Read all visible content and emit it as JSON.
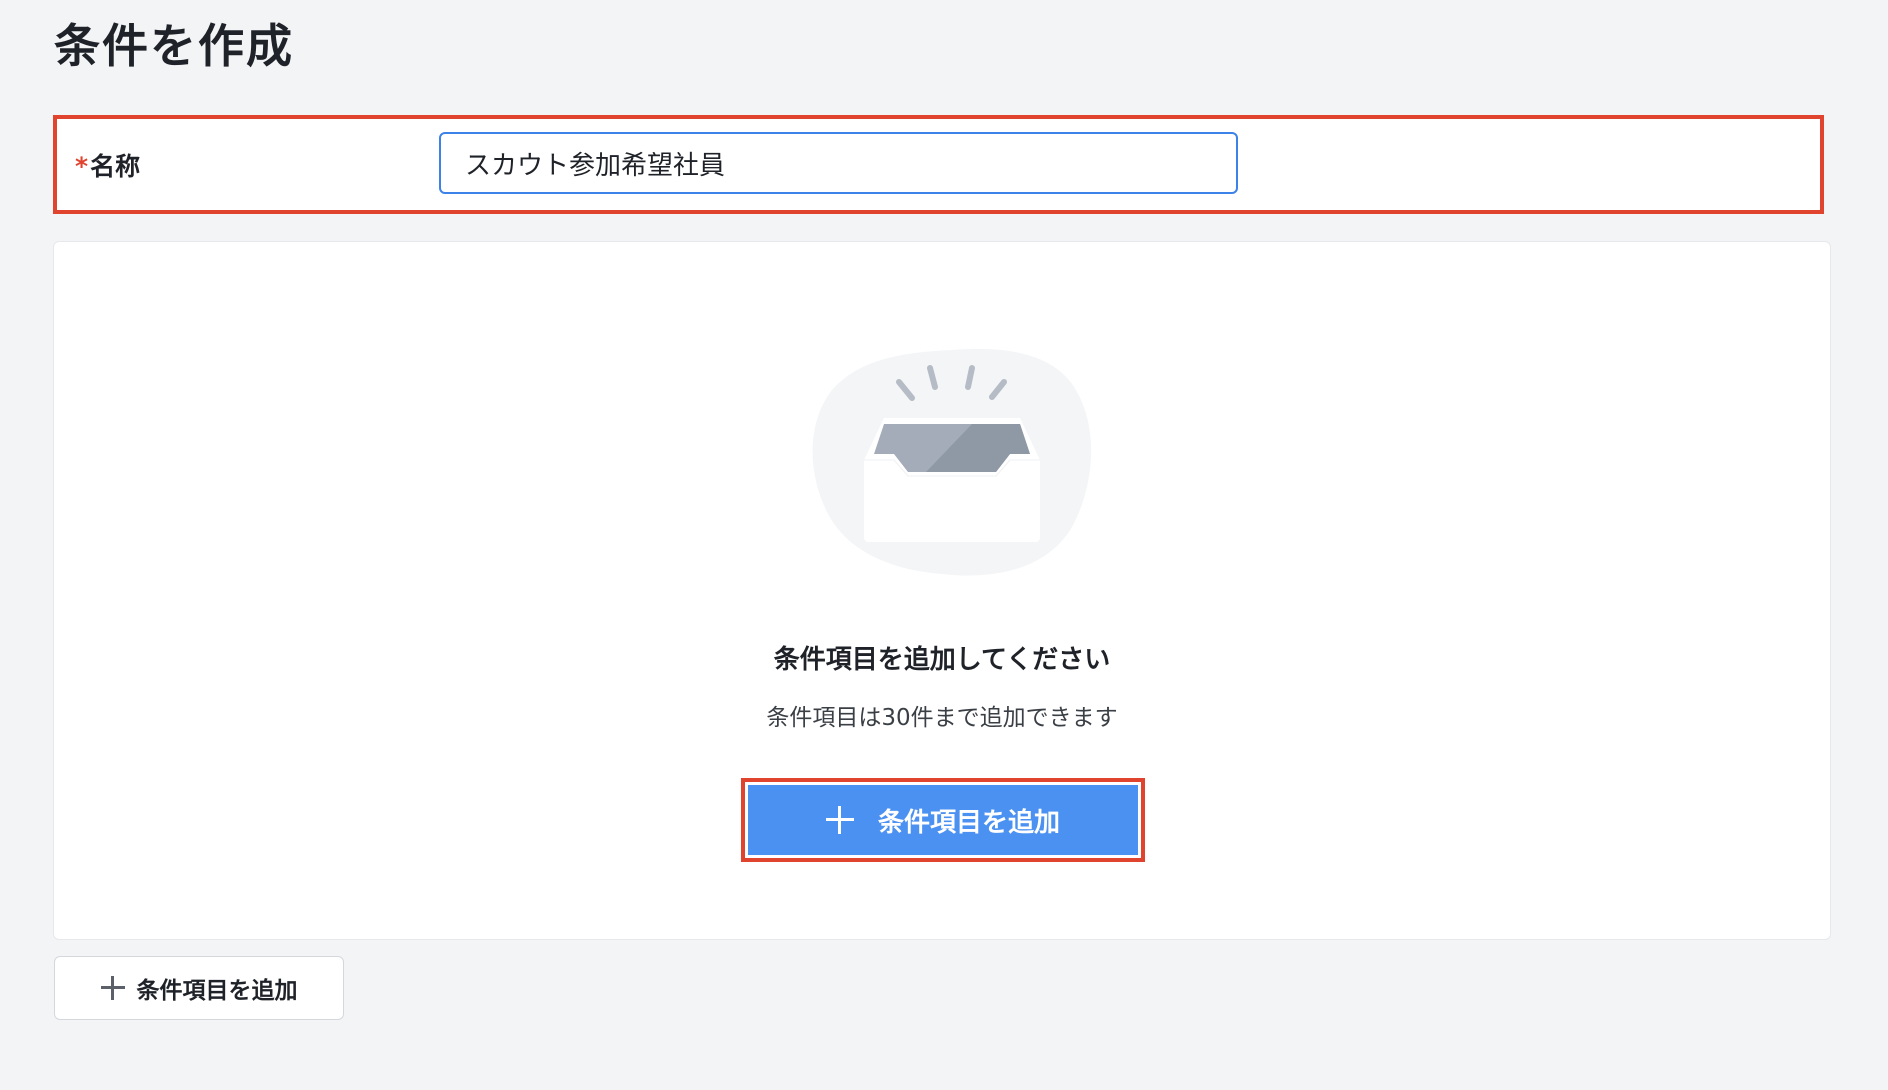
{
  "page": {
    "title": "条件を作成"
  },
  "name_field": {
    "required_mark": "*",
    "label": "名称",
    "value": "スカウト参加希望社員"
  },
  "empty_state": {
    "icon": "empty-box-icon",
    "title": "条件項目を追加してください",
    "description": "条件項目は30件まで追加できます",
    "add_button_label": "条件項目を追加"
  },
  "footer": {
    "add_button_label": "条件項目を追加"
  },
  "colors": {
    "background": "#f3f4f6",
    "primary": "#4b91f1",
    "highlight_border": "#e0432e",
    "input_border": "#3d82e8"
  }
}
